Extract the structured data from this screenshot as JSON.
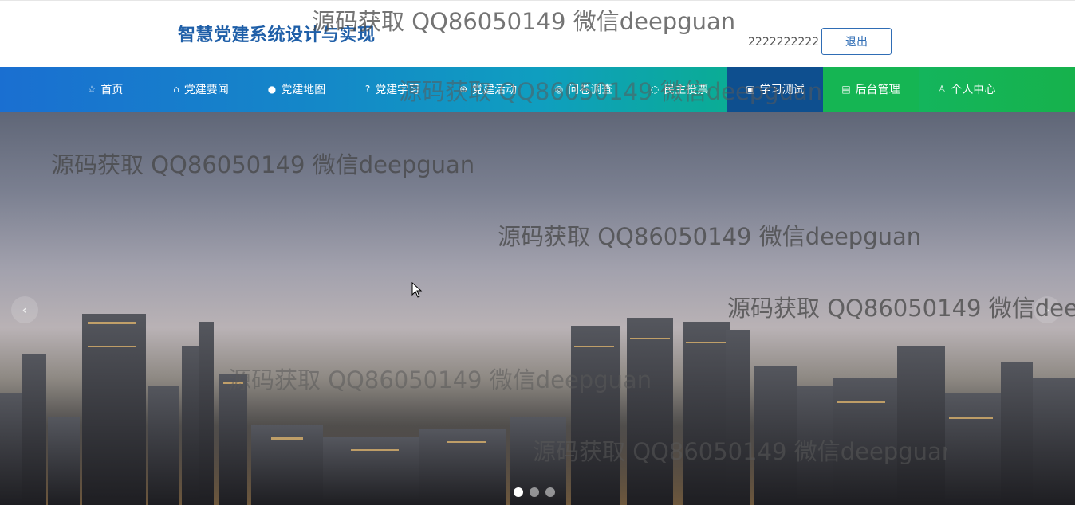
{
  "header": {
    "title": "智慧党建系统设计与实现",
    "username": "2222222222",
    "logout_label": "退出"
  },
  "nav": {
    "items": [
      {
        "icon": "star-icon",
        "glyph": "☆",
        "label": "首页"
      },
      {
        "icon": "bag-icon",
        "glyph": "⌂",
        "label": "党建要闻"
      },
      {
        "icon": "info-icon",
        "glyph": "●",
        "label": "党建地图"
      },
      {
        "icon": "question-icon",
        "glyph": "?",
        "label": "党建学习"
      },
      {
        "icon": "globe-icon",
        "glyph": "⊕",
        "label": "党建活动"
      },
      {
        "icon": "compass-icon",
        "glyph": "◎",
        "label": "问卷调查"
      },
      {
        "icon": "vote-icon",
        "glyph": "◌",
        "label": "民主投票"
      },
      {
        "icon": "camera-icon",
        "glyph": "▣",
        "label": "学习测试"
      },
      {
        "icon": "building-icon",
        "glyph": "▤",
        "label": "后台管理"
      },
      {
        "icon": "user-icon",
        "glyph": "♙",
        "label": "个人中心"
      }
    ],
    "active_index": 7
  },
  "carousel": {
    "prev_glyph": "‹",
    "next_glyph": "›",
    "slide_count": 3,
    "active_slide": 1
  },
  "watermark": {
    "text": "源码获取 QQ86050149 微信deepguan"
  }
}
